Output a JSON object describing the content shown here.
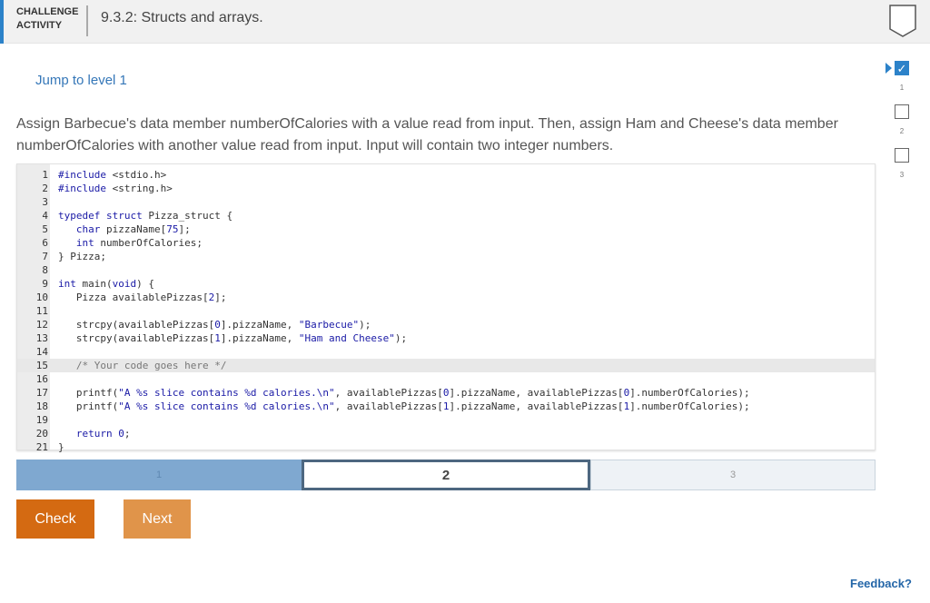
{
  "header": {
    "label_line1": "CHALLENGE",
    "label_line2": "ACTIVITY",
    "title": "9.3.2: Structs and arrays."
  },
  "jump_link": "Jump to level 1",
  "instructions": "Assign Barbecue's data member numberOfCalories with a value read from input. Then, assign Ham and Cheese's data member numberOfCalories with another value read from input. Input will contain two integer numbers.",
  "editor": {
    "lines": [
      {
        "n": "1",
        "html": "<span class=\"kw\">#include</span> &lt;stdio.h&gt;"
      },
      {
        "n": "2",
        "html": "<span class=\"kw\">#include</span> &lt;string.h&gt;"
      },
      {
        "n": "3",
        "html": ""
      },
      {
        "n": "4",
        "html": "<span class=\"kw\">typedef</span> <span class=\"kw\">struct</span> Pizza_struct {"
      },
      {
        "n": "5",
        "html": "   <span class=\"kw\">char</span> pizzaName[<span class=\"num\">75</span>];"
      },
      {
        "n": "6",
        "html": "   <span class=\"kw\">int</span> numberOfCalories;"
      },
      {
        "n": "7",
        "html": "} Pizza;"
      },
      {
        "n": "8",
        "html": ""
      },
      {
        "n": "9",
        "html": "<span class=\"kw\">int</span> main(<span class=\"kw\">void</span>) {"
      },
      {
        "n": "10",
        "html": "   Pizza availablePizzas[<span class=\"num\">2</span>];"
      },
      {
        "n": "11",
        "html": ""
      },
      {
        "n": "12",
        "html": "   strcpy(availablePizzas[<span class=\"num\">0</span>].pizzaName, <span class=\"str\">\"Barbecue\"</span>);"
      },
      {
        "n": "13",
        "html": "   strcpy(availablePizzas[<span class=\"num\">1</span>].pizzaName, <span class=\"str\">\"Ham and Cheese\"</span>);"
      },
      {
        "n": "14",
        "html": ""
      },
      {
        "n": "15",
        "html": "   <span class=\"cm\">/* Your code goes here */</span>",
        "active": true
      },
      {
        "n": "16",
        "html": ""
      },
      {
        "n": "17",
        "html": "   printf(<span class=\"str\">\"A %s slice contains %d calories.\\n\"</span>, availablePizzas[<span class=\"num\">0</span>].pizzaName, availablePizzas[<span class=\"num\">0</span>].numberOfCalories);"
      },
      {
        "n": "18",
        "html": "   printf(<span class=\"str\">\"A %s slice contains %d calories.\\n\"</span>, availablePizzas[<span class=\"num\">1</span>].pizzaName, availablePizzas[<span class=\"num\">1</span>].numberOfCalories);"
      },
      {
        "n": "19",
        "html": ""
      },
      {
        "n": "20",
        "html": "   <span class=\"kw\">return</span> <span class=\"num\">0</span>;"
      },
      {
        "n": "21",
        "html": "}"
      }
    ]
  },
  "levels": [
    {
      "label": "1",
      "state": "done"
    },
    {
      "label": "2",
      "state": "current"
    },
    {
      "label": "3",
      "state": "todo"
    }
  ],
  "buttons": {
    "check": "Check",
    "next": "Next"
  },
  "progress": [
    {
      "label": "1",
      "checked": true,
      "current": true
    },
    {
      "label": "2",
      "checked": false,
      "current": false
    },
    {
      "label": "3",
      "checked": false,
      "current": false
    }
  ],
  "feedback": "Feedback?",
  "colors": {
    "accent": "#2c82c9",
    "check_button": "#d46a12",
    "next_button": "#e0944a",
    "level_done": "#7fa8d0"
  },
  "icons": {
    "header_badge": "shield-icon",
    "checked_box": "checkmark-icon",
    "current_pointer": "arrow-right-icon"
  }
}
